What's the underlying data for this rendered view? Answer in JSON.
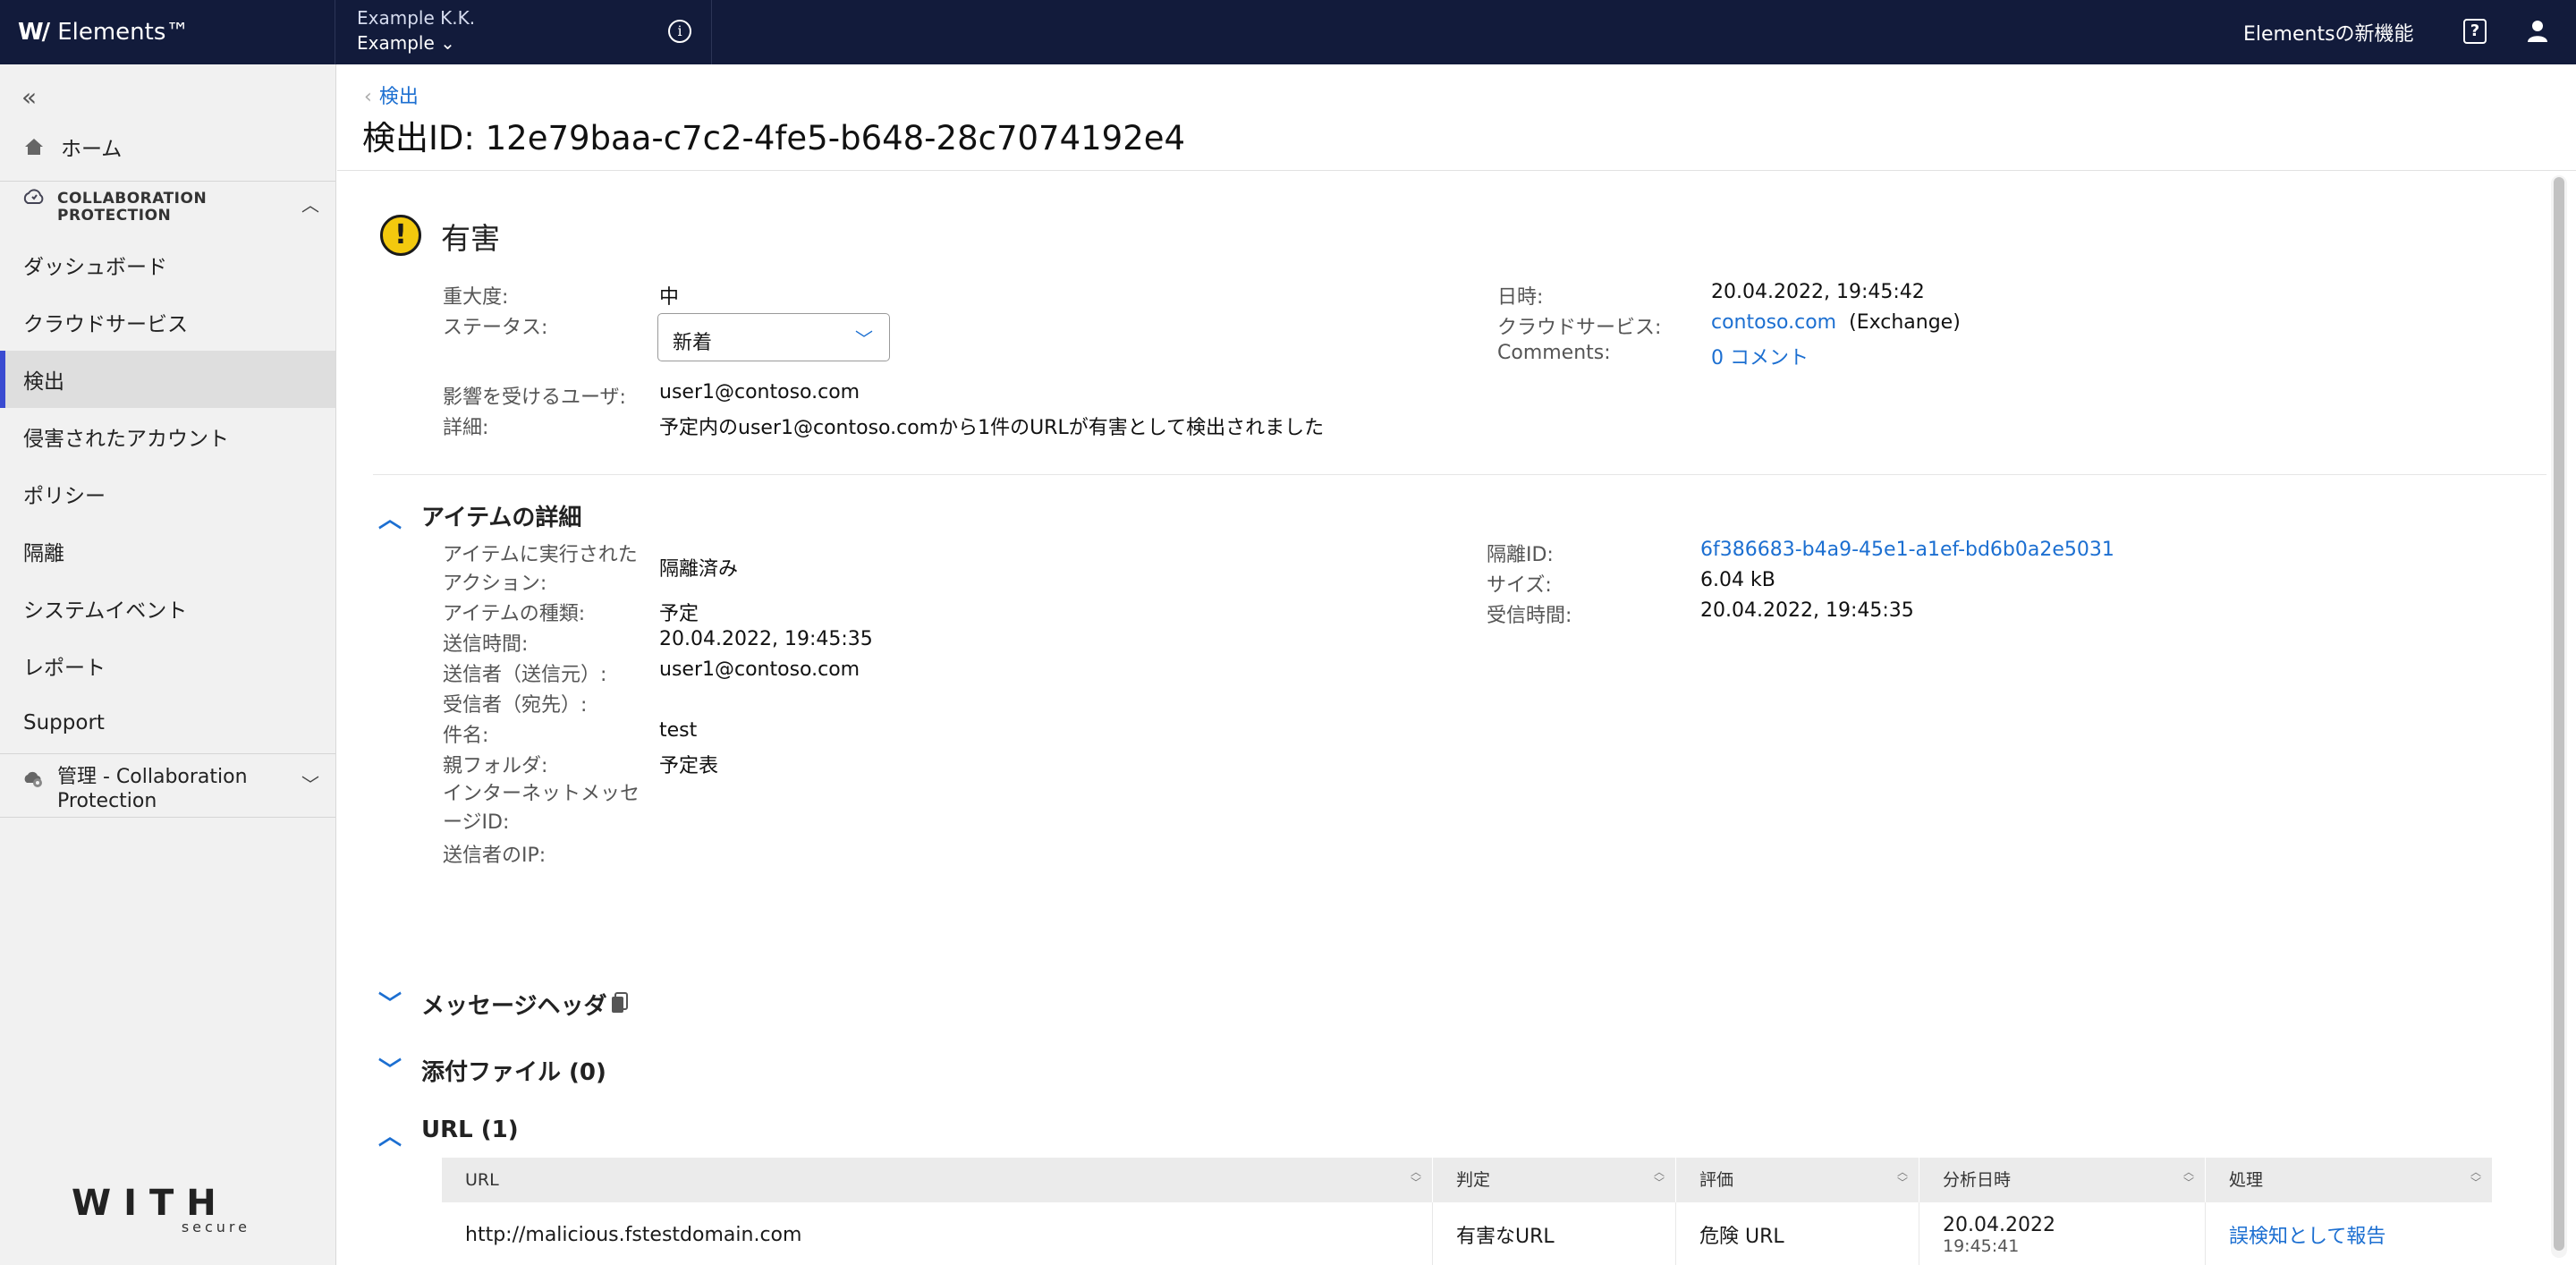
{
  "topbar": {
    "brand": "Elements™",
    "org_name": "Example K.K.",
    "org_sub": "Example",
    "info_icon": "i",
    "whats_new": "Elementsの新機能",
    "help_icon": "?"
  },
  "sidebar": {
    "home": "ホーム",
    "section_title_1": "COLLABORATION",
    "section_title_2": "PROTECTION",
    "items": [
      "ダッシュボード",
      "クラウドサービス",
      "検出",
      "侵害されたアカウント",
      "ポリシー",
      "隔離",
      "システムイベント",
      "レポート",
      "Support"
    ],
    "active_index": 2,
    "admin_label": "管理 - Collaboration Protection",
    "footer_logo": "WITH",
    "footer_logo_sub": "secure"
  },
  "header": {
    "breadcrumb": "検出",
    "title": "検出ID: 12e79baa-c7c2-4fe5-b648-28c7074192e4"
  },
  "summary": {
    "verdict": "有害",
    "severity_label": "重大度:",
    "severity_value": "中",
    "status_label": "ステータス:",
    "status_value": "新着",
    "affected_user_label": "影響を受けるユーザ:",
    "affected_user_value": "user1@contoso.com",
    "details_label": "詳細:",
    "details_value": "予定内のuser1@contoso.comから1件のURLが有害として検出されました",
    "datetime_label": "日時:",
    "datetime_value": "20.04.2022, 19:45:42",
    "cloud_label": "クラウドサービス:",
    "cloud_link": "contoso.com",
    "cloud_suffix": "(Exchange)",
    "comments_label": "Comments:",
    "comments_value": "0 コメント"
  },
  "item_details": {
    "heading": "アイテムの詳細",
    "action_label_1": "アイテムに実行された",
    "action_label_2": "アクション:",
    "action_value": "隔離済み",
    "type_label": "アイテムの種類:",
    "type_value": "予定",
    "sent_label": "送信時間:",
    "sent_value": "20.04.2022, 19:45:35",
    "sender_label": "送信者（送信元）:",
    "sender_value": "user1@contoso.com",
    "recipient_label": "受信者（宛先）:",
    "subject_label": "件名:",
    "subject_value": "test",
    "parent_label": "親フォルダ:",
    "parent_value": "予定表",
    "msgid_label_1": "インターネットメッセ",
    "msgid_label_2": "ージID:",
    "sender_ip_label": "送信者のIP:",
    "quarantine_label": "隔離ID:",
    "quarantine_value": "6f386683-b4a9-45e1-a1ef-bd6b0a2e5031",
    "size_label": "サイズ:",
    "size_value": "6.04 kB",
    "received_label": "受信時間:",
    "received_value": "20.04.2022, 19:45:35"
  },
  "message_headers": {
    "heading": "メッセージヘッダ"
  },
  "attachments": {
    "heading": "添付ファイル (0)"
  },
  "urls": {
    "heading": "URL (1)",
    "columns": [
      "URL",
      "判定",
      "評価",
      "分析日時",
      "処理"
    ],
    "rows": [
      {
        "url": "http://malicious.fstestdomain.com",
        "verdict": "有害なURL",
        "rating": "危険 URL",
        "date": "20.04.2022",
        "time": "19:45:41",
        "action": "誤検知として報告"
      }
    ]
  }
}
